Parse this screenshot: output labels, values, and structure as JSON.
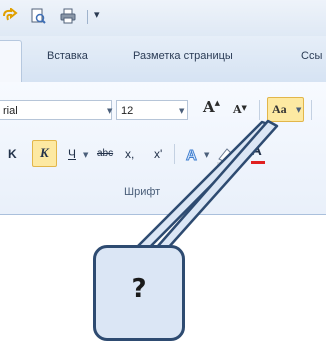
{
  "quick_access": {
    "icons": [
      "undo-icon",
      "print-preview-icon",
      "print-icon"
    ],
    "customize_arrow": "▾"
  },
  "tabs": [
    {
      "label": "",
      "active": true
    },
    {
      "label": "Вставка",
      "active": false
    },
    {
      "label": "Разметка страницы",
      "active": false
    },
    {
      "label": "Ссы",
      "active": false
    }
  ],
  "font_group": {
    "font_name": "rial",
    "font_size": "12",
    "grow_label": "A",
    "shrink_label": "A",
    "change_case_label": "Aa",
    "bold_label": "K",
    "italic_label": "K",
    "underline_label": "Ч",
    "strike_label": "abc",
    "subscript_label": "x,",
    "superscript_label": "x'",
    "group_label": "Шрифт"
  },
  "callout": {
    "text": "?"
  },
  "colors": {
    "ribbon_top": "#e6eef8",
    "highlight": "#fde9a2",
    "highlight_border": "#e2b64a",
    "callout_fill": "#dbe6f5",
    "callout_border": "#2e4b71"
  }
}
